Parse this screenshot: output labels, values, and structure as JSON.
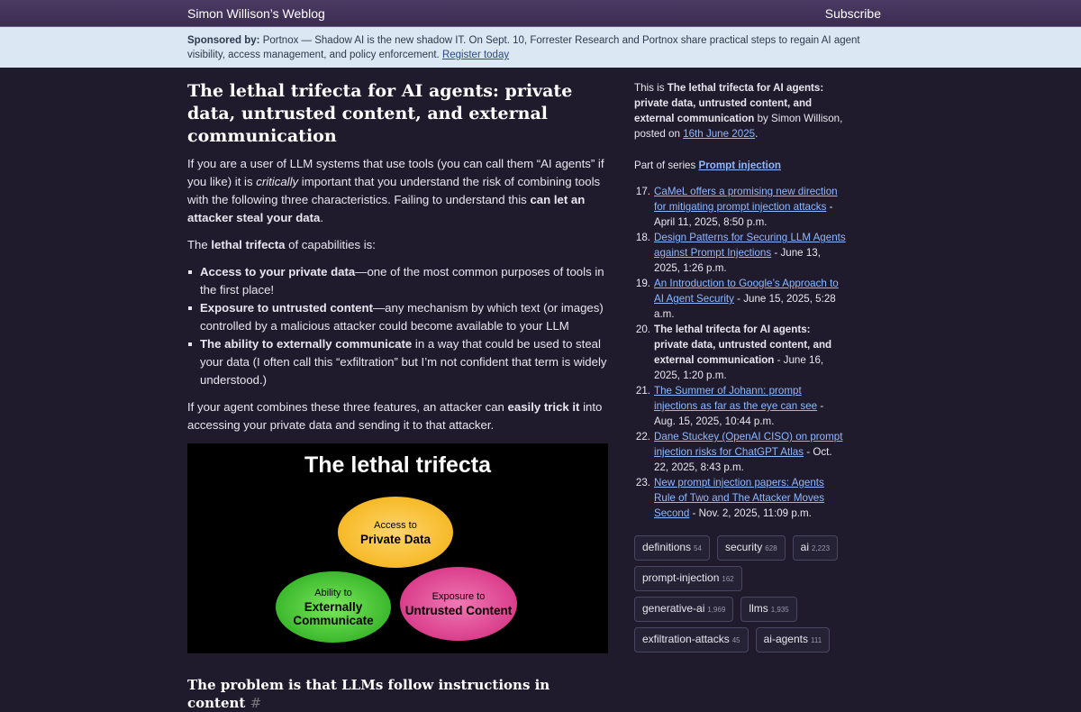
{
  "header": {
    "brand": "Simon Willison’s Weblog",
    "subscribe": "Subscribe"
  },
  "sponsor": {
    "label": "Sponsored by:",
    "text": " Portnox — Shadow AI is the new shadow IT. On Sept. 10, Forrester Research and Portnox share practical steps to regain AI agent visibility, access management, and policy enforcement. ",
    "link": "Register today"
  },
  "article": {
    "title": "The lethal trifecta for AI agents: private data, untrusted content, and external communication",
    "p1_a": "If you are a user of LLM systems that use tools (you can call them “AI agents” if you like) it is ",
    "p1_em": "critically",
    "p1_b": " important that you understand the risk of combining tools with the following three characteristics. Failing to understand this ",
    "p1_strong": "can let an attacker steal your data",
    "p1_c": ".",
    "p2_a": "The ",
    "p2_strong": "lethal trifecta",
    "p2_b": " of capabilities is:",
    "bullets": [
      {
        "strong": "Access to your private data",
        "text": "—one of the most common purposes of tools in the first place!"
      },
      {
        "strong": "Exposure to untrusted content",
        "text": "—any mechanism by which text (or images) controlled by a malicious attacker could become available to your LLM"
      },
      {
        "strong": "The ability to externally communicate",
        "text": " in a way that could be used to steal your data (I often call this “exfiltration” but I’m not confident that term is widely understood.)"
      }
    ],
    "p3_a": "If your agent combines these three features, an attacker can ",
    "p3_strong": "easily trick it",
    "p3_b": " into accessing your private data and sending it to that attacker.",
    "diagram": {
      "title": "The lethal trifecta",
      "top_small": "Access to",
      "top_big": "Private Data",
      "left_small": "Ability to",
      "left_big1": "Externally",
      "left_big2": "Communicate",
      "right_small": "Exposure to",
      "right_big": "Untrusted Content"
    },
    "h2": "The problem is that LLMs follow instructions in content",
    "h2_hash": "#"
  },
  "sidebar": {
    "intro_a": "This is ",
    "intro_title": "The lethal trifecta for AI agents: private data, untrusted content, and external communication",
    "intro_b": " by Simon Willison, posted on ",
    "intro_date": "16th June 2025",
    "intro_c": ".",
    "series_prefix": "Part of series ",
    "series_name": "Prompt injection",
    "series": [
      {
        "num": "17.",
        "title": "CaMeL offers a promising new direction for mitigating prompt injection attacks",
        "date": " - April 11, 2025, 8:50 p.m.",
        "current": false
      },
      {
        "num": "18.",
        "title": "Design Patterns for Securing LLM Agents against Prompt Injections",
        "date": " - June 13, 2025, 1:26 p.m.",
        "current": false
      },
      {
        "num": "19.",
        "title": "An Introduction to Google’s Approach to AI Agent Security",
        "date": " - June 15, 2025, 5:28 a.m.",
        "current": false
      },
      {
        "num": "20.",
        "title": "The lethal trifecta for AI agents: private data, untrusted content, and external communication",
        "date": " - June 16, 2025, 1:20 p.m.",
        "current": true
      },
      {
        "num": "21.",
        "title": "The Summer of Johann: prompt injections as far as the eye can see",
        "date": " - Aug. 15, 2025, 10:44 p.m.",
        "current": false
      },
      {
        "num": "22.",
        "title": "Dane Stuckey (OpenAI CISO) on prompt injection risks for ChatGPT Atlas",
        "date": " - Oct. 22, 2025, 8:43 p.m.",
        "current": false
      },
      {
        "num": "23.",
        "title": "New prompt injection papers: Agents Rule of Two and The Attacker Moves Second",
        "date": " - Nov. 2, 2025, 11:09 p.m.",
        "current": false
      }
    ],
    "tags": [
      {
        "name": "definitions",
        "count": "54"
      },
      {
        "name": "security",
        "count": "628"
      },
      {
        "name": "ai",
        "count": "2,223"
      },
      {
        "name": "prompt-injection",
        "count": "162"
      },
      {
        "name": "generative-ai",
        "count": "1,969"
      },
      {
        "name": "llms",
        "count": "1,935"
      },
      {
        "name": "exfiltration-attacks",
        "count": "45"
      },
      {
        "name": "ai-agents",
        "count": "111"
      }
    ]
  }
}
